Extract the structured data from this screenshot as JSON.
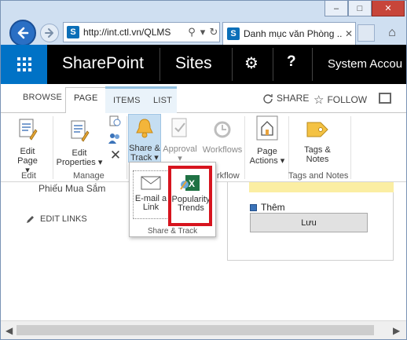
{
  "browser": {
    "url": "http://int.ctl.vn/QLMS",
    "tab_title": "Danh mục văn Phòng ...",
    "sp_badge": "S",
    "window_buttons": [
      "–",
      "□",
      "✕"
    ]
  },
  "suitebar": {
    "brand": "SharePoint",
    "sites": "Sites",
    "help": "?",
    "account": "System Accou"
  },
  "ribbon_tabs": {
    "browse": "BROWSE",
    "page": "PAGE",
    "items": "ITEMS",
    "list": "LIST",
    "share": "SHARE",
    "follow": "FOLLOW"
  },
  "ribbon": {
    "edit_page": [
      "Edit Page",
      "▾"
    ],
    "edit_properties": [
      "Edit",
      "Properties ▾"
    ],
    "share_track": [
      "Share &",
      "Track ▾"
    ],
    "approval": [
      "Approval",
      "▾"
    ],
    "workflows": "Workflows",
    "page_actions": [
      "Page",
      "Actions ▾"
    ],
    "tags_notes": [
      "Tags &",
      "Notes"
    ],
    "groups": {
      "edit": "Edit",
      "manage": "Manage",
      "workflow": "rkflow",
      "tags_notes": "Tags and Notes"
    }
  },
  "flyout": {
    "email_link": [
      "E-mail a",
      "Link"
    ],
    "popularity_trends": [
      "Popularity",
      "Trends"
    ],
    "group_label": "Share & Track"
  },
  "page": {
    "leftnav_title": "Phiếu Mua Sắm",
    "edit_links": "EDIT LINKS",
    "them": "Thêm",
    "luu": "Lưu"
  },
  "colors": {
    "suitebar": "#000000",
    "waffle": "#0072c6",
    "highlight_box": "#d7141e",
    "selected_button": "#c5def2"
  }
}
